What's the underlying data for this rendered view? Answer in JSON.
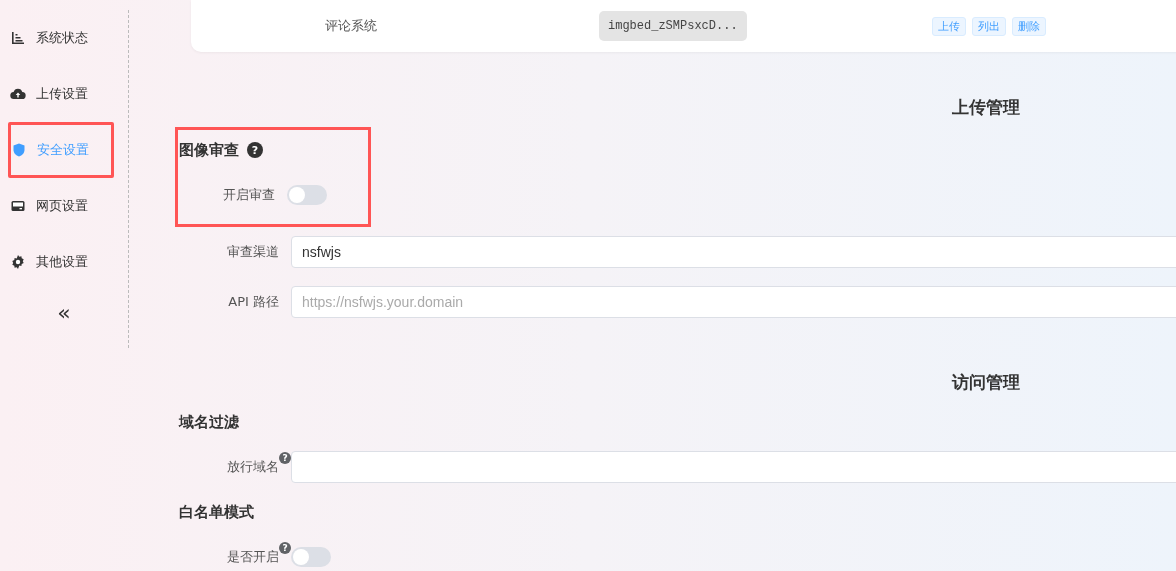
{
  "sidebar": {
    "items": [
      {
        "label": "系统状态",
        "selected": false,
        "highlighted": false
      },
      {
        "label": "上传设置",
        "selected": false,
        "highlighted": false
      },
      {
        "label": "安全设置",
        "selected": true,
        "highlighted": true
      },
      {
        "label": "网页设置",
        "selected": false,
        "highlighted": false
      },
      {
        "label": "其他设置",
        "selected": false,
        "highlighted": false
      }
    ],
    "collapse": "«"
  },
  "token_row": {
    "name": "评论系统",
    "token": "imgbed_zSMPsxcD...",
    "actions": [
      "上传",
      "列出",
      "删除"
    ]
  },
  "sections": [
    {
      "title": "上传管理",
      "groups": [
        {
          "title": "图像审查",
          "help": "?",
          "highlighted": true,
          "fields": [
            {
              "kind": "switch",
              "label": "开启审查",
              "on": false
            }
          ]
        },
        {
          "highlighted": false,
          "fields": [
            {
              "kind": "input",
              "label": "审查渠道",
              "value": "nsfwjs"
            },
            {
              "kind": "input",
              "label": "API 路径",
              "placeholder": "https://nsfwjs.your.domain"
            }
          ]
        }
      ]
    },
    {
      "title": "访问管理",
      "groups": [
        {
          "title": "域名过滤",
          "highlighted": false,
          "fields": [
            {
              "kind": "input",
              "label": "放行域名",
              "help": "?"
            }
          ]
        },
        {
          "title": "白名单模式",
          "highlighted": false,
          "fields": [
            {
              "kind": "switch",
              "label": "是否开启",
              "help": "?",
              "on": false
            }
          ]
        }
      ]
    }
  ]
}
